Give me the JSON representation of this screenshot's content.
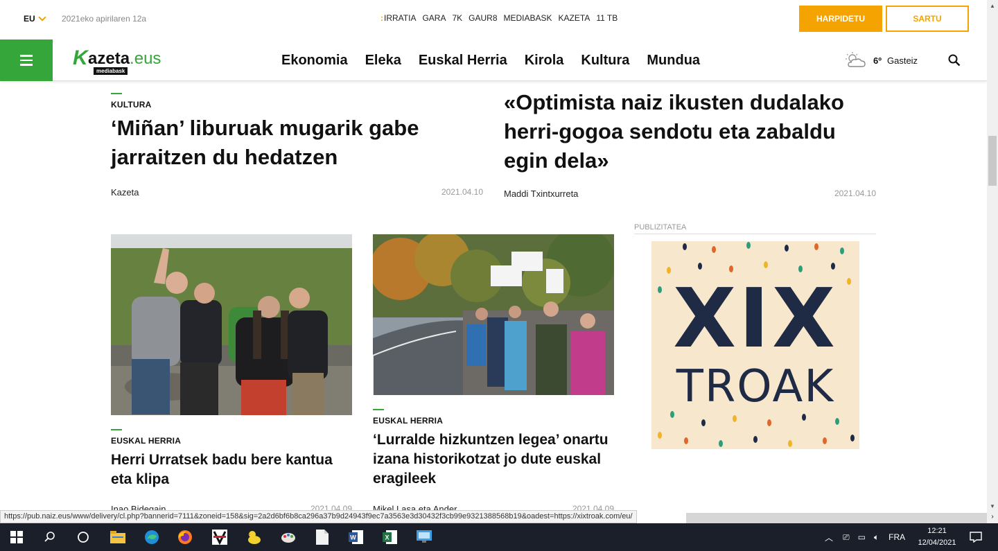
{
  "topbar": {
    "lang": "EU",
    "date": "2021eko apirilaren 12a",
    "partners": [
      "IRRATIA",
      "GARA",
      "7K",
      "GAUR8",
      "MEDIABASK",
      "KAZETA",
      "11 TB"
    ],
    "subscribe_label": "HARPIDETU",
    "login_label": "SARTU"
  },
  "logo": {
    "k": "K",
    "rest": "azeta",
    "eus": ".eus",
    "sub": "mediabask"
  },
  "nav": {
    "items": [
      "Ekonomia",
      "Eleka",
      "Euskal Herria",
      "Kirola",
      "Kultura",
      "Mundua"
    ]
  },
  "weather": {
    "temp": "6º",
    "city": "Gasteiz"
  },
  "articles": [
    {
      "section": "KULTURA",
      "title": "‘Miñan’ liburuak mugarik gabe jarraitzen du hedatzen",
      "author": "Kazeta",
      "date": "2021.04.10"
    },
    {
      "section": "",
      "title": "«Optimista naiz ikusten dudalako herri-gogoa sendotu eta zabaldu egin dela»",
      "author": "Maddi Txintxurreta",
      "date": "2021.04.10"
    },
    {
      "section": "EUSKAL HERRIA",
      "title": "Herri Urratsek badu bere kantua eta klipa",
      "author": "Inao Bidegain",
      "date": "2021.04.09"
    },
    {
      "section": "EUSKAL HERRIA",
      "title": "‘Lurralde hizkuntzen legea’ onartu izana historikotzat jo dute euskal eragileek",
      "author": "Mikel Lasa eta Ander",
      "date": "2021.04.09"
    }
  ],
  "ad": {
    "label": "PUBLIZITATEA",
    "line1": "XIX",
    "line2": "TROAK"
  },
  "status_url": "https://pub.naiz.eus/www/delivery/cl.php?bannerid=7111&zoneid=158&sig=2a2d6bf6b8ca296a37b9d24943f9ec7a3563e3d30432f3cb99e9321388568b19&oadest=https://xixtroak.com/eu/",
  "taskbar": {
    "lang": "FRA",
    "time": "12:21",
    "date": "12/04/2021"
  },
  "colors": {
    "accent_orange": "#f5a300",
    "accent_green": "#35a639",
    "taskbar_bg": "#1a1f2a"
  }
}
